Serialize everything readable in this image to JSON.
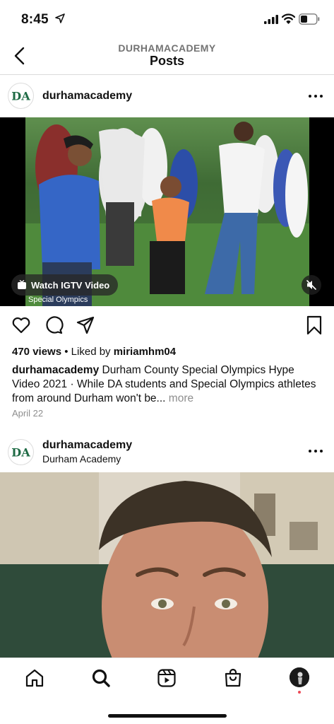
{
  "status_bar": {
    "time": "8:45"
  },
  "nav": {
    "account_label": "DURHAMACADEMY",
    "title": "Posts"
  },
  "post1": {
    "username": "durhamacademy",
    "video": {
      "watch_label": "Watch IGTV Video",
      "caption_overlay": "Special Olympics"
    },
    "views": "470 views",
    "separator": "•",
    "liked_by_prefix": "Liked by",
    "liked_by_user": "miriamhm04",
    "caption_user": "durhamacademy",
    "caption_text": "Durham County Special Olympics Hype Video 2021 · While DA students and Special Olympics athletes from around Durham won't be...",
    "more_label": "more",
    "date": "April 22"
  },
  "post2": {
    "username": "durhamacademy",
    "location": "Durham Academy"
  },
  "icons": {
    "back": "chevron-left-icon",
    "options": "more-options-icon",
    "like": "heart-icon",
    "comment": "comment-icon",
    "share": "paper-plane-icon",
    "save": "bookmark-icon",
    "igtv": "igtv-icon",
    "mute": "speaker-muted-icon",
    "home": "home-icon",
    "search": "search-icon",
    "reels": "reels-icon",
    "shop": "shopping-bag-icon"
  },
  "colors": {
    "brand_green": "#1f6b45",
    "secondary_text": "#8e8e8e",
    "notification": "#ed4956"
  }
}
